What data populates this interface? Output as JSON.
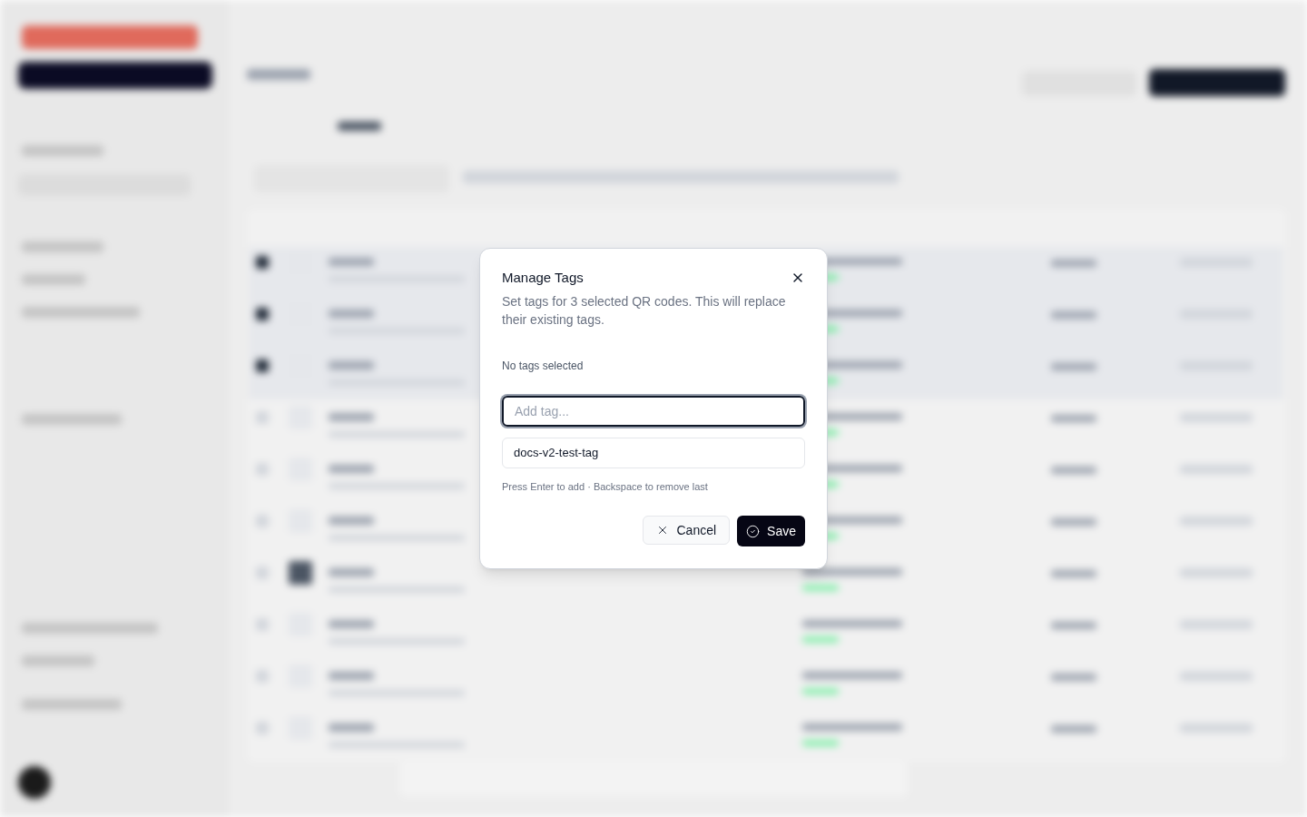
{
  "dialog": {
    "title": "Manage Tags",
    "description": "Set tags for 3 selected QR codes. This will replace their existing tags.",
    "selection_status": "No tags selected",
    "tag_input": {
      "placeholder": "Add tag..."
    },
    "suggestions": [
      {
        "label": "docs-v2-test-tag"
      }
    ],
    "hint": "Press Enter to add · Backspace to remove last",
    "buttons": [
      {
        "label": "Cancel",
        "kind": "secondary"
      },
      {
        "label": "Save",
        "kind": "primary"
      }
    ]
  }
}
